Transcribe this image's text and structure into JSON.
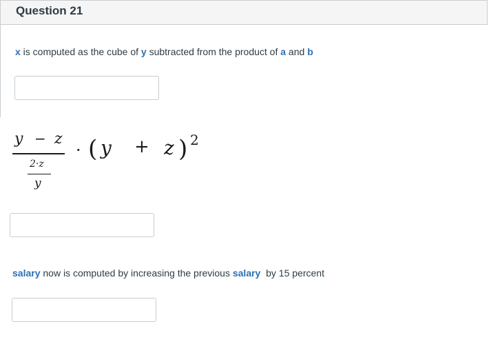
{
  "question": {
    "title": "Question 21"
  },
  "item1": {
    "parts": [
      {
        "text": "x",
        "kind": "var"
      },
      {
        "text": " is computed as the cube of ",
        "kind": "text"
      },
      {
        "text": "y",
        "kind": "var"
      },
      {
        "text": " subtracted from the product of ",
        "kind": "text"
      },
      {
        "text": "a",
        "kind": "var"
      },
      {
        "text": " and ",
        "kind": "text"
      },
      {
        "text": "b",
        "kind": "var"
      }
    ]
  },
  "math": {
    "num_left": "y",
    "num_op": "−",
    "num_right": "z",
    "den_num": "2·z",
    "den_den": "y",
    "dot": "·",
    "lparen": "(",
    "y": "y",
    "plus": "+",
    "z": "z",
    "rparen": ")",
    "exp": "2"
  },
  "item3": {
    "parts": [
      {
        "text": "salary",
        "kind": "var"
      },
      {
        "text": " now is computed by increasing the previous ",
        "kind": "text"
      },
      {
        "text": "salary",
        "kind": "var"
      },
      {
        "text": "  by 15 percent",
        "kind": "text"
      }
    ]
  }
}
